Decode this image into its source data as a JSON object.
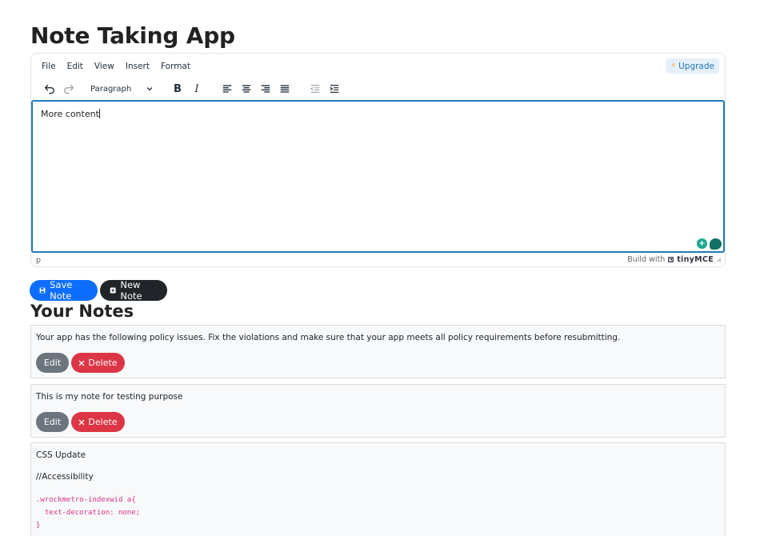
{
  "page": {
    "title": "Note Taking App"
  },
  "editor": {
    "menu": [
      "File",
      "Edit",
      "View",
      "Insert",
      "Format"
    ],
    "upgrade_label": "Upgrade",
    "block_format": "Paragraph",
    "content": "More content",
    "status_path": "p",
    "branding_prefix": "Build with",
    "branding_name": "tinyMCE",
    "accent_color": "#207ab7"
  },
  "actions": {
    "save_label": "Save Note",
    "new_label": "New Note"
  },
  "notes_section": {
    "title": "Your Notes",
    "notes": [
      {
        "text": "Your app has the following policy issues. Fix the violations and make sure that your app meets all policy requirements before resubmitting.",
        "edit_label": "Edit",
        "delete_label": "Delete"
      },
      {
        "text": "This is my note for testing purpose",
        "edit_label": "Edit",
        "delete_label": "Delete"
      },
      {
        "heading": "CSS Update",
        "subheading": "//Accessibility",
        "code": ".wrockmetro-indexwid a{\n  text-decoration: none;\n}"
      }
    ]
  },
  "colors": {
    "primary": "#0d6efd",
    "dark": "#212529",
    "secondary": "#6c757d",
    "danger": "#dc3545"
  }
}
